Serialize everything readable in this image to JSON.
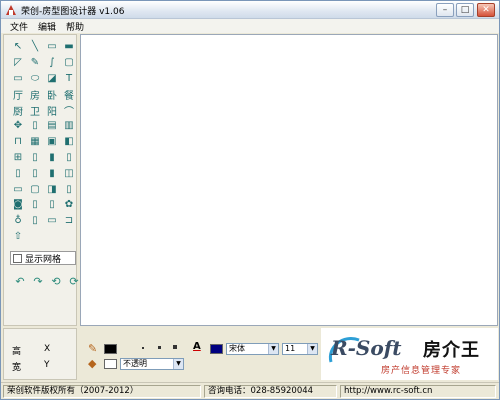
{
  "window": {
    "title": "荣创-房型图设计器 v1.06",
    "buttons": {
      "minimize": "–",
      "maximize": "□",
      "close": "✕"
    }
  },
  "menu": {
    "items": [
      "文件",
      "编辑",
      "帮助"
    ]
  },
  "toolbox": {
    "tools": [
      {
        "name": "pointer-icon",
        "glyph": "↖"
      },
      {
        "name": "line-icon",
        "glyph": "╲"
      },
      {
        "name": "rectangle-icon",
        "glyph": "▭"
      },
      {
        "name": "filled-rectangle-icon",
        "glyph": "▬"
      },
      {
        "name": "eraser-icon",
        "glyph": "◸"
      },
      {
        "name": "pencil-icon",
        "glyph": "✎"
      },
      {
        "name": "curve-icon",
        "glyph": "∫"
      },
      {
        "name": "rounded-rectangle-icon",
        "glyph": "▢"
      },
      {
        "name": "ellipse-filled-icon",
        "glyph": "▭"
      },
      {
        "name": "ellipse-icon",
        "glyph": "⬭"
      },
      {
        "name": "shape-icon",
        "glyph": "◪"
      },
      {
        "name": "text-tool-icon",
        "glyph": "T"
      },
      {
        "name": "kitchen-label-icon",
        "glyph": "厅"
      },
      {
        "name": "room-label-icon",
        "glyph": "房"
      },
      {
        "name": "bedroom-label-icon",
        "glyph": "卧"
      },
      {
        "name": "dining-label-icon",
        "glyph": "餐"
      },
      {
        "name": "cook-label-icon",
        "glyph": "厨"
      },
      {
        "name": "bath-label-icon",
        "glyph": "卫"
      },
      {
        "name": "balcony-label-icon",
        "glyph": "阳"
      },
      {
        "name": "door-arc-icon",
        "glyph": "⌒"
      },
      {
        "name": "compass-icon",
        "glyph": "✥"
      },
      {
        "name": "door-icon",
        "glyph": "▯"
      },
      {
        "name": "window-icon",
        "glyph": "▤"
      },
      {
        "name": "cabinet-icon",
        "glyph": "▥"
      },
      {
        "name": "sofa-icon",
        "glyph": "⊓"
      },
      {
        "name": "bed-icon",
        "glyph": "▦"
      },
      {
        "name": "table-icon",
        "glyph": "▣"
      },
      {
        "name": "closet-icon",
        "glyph": "◧"
      },
      {
        "name": "double-door-icon",
        "glyph": "⊞"
      },
      {
        "name": "narrow-cabinet-icon",
        "glyph": "▯"
      },
      {
        "name": "panel-icon",
        "glyph": "▮"
      },
      {
        "name": "shelf-icon",
        "glyph": "▯"
      },
      {
        "name": "column-icon",
        "glyph": "▯"
      },
      {
        "name": "pillar-icon",
        "glyph": "▯"
      },
      {
        "name": "stand-icon",
        "glyph": "▮"
      },
      {
        "name": "frame-icon",
        "glyph": "◫"
      },
      {
        "name": "desk-icon",
        "glyph": "▭"
      },
      {
        "name": "tv-icon",
        "glyph": "▢"
      },
      {
        "name": "box-icon",
        "glyph": "◨"
      },
      {
        "name": "stool-icon",
        "glyph": "▯"
      },
      {
        "name": "sink-icon",
        "glyph": "◙"
      },
      {
        "name": "bathtub-icon",
        "glyph": "▯"
      },
      {
        "name": "fridge-icon",
        "glyph": "▯"
      },
      {
        "name": "dining-set-icon",
        "glyph": "✿"
      },
      {
        "name": "toilet-icon",
        "glyph": "♁"
      },
      {
        "name": "washer-icon",
        "glyph": "▯"
      },
      {
        "name": "stove-icon",
        "glyph": "▭"
      },
      {
        "name": "stairs-icon",
        "glyph": "⊐"
      },
      {
        "name": "arrow-up-icon",
        "glyph": "⇧"
      }
    ],
    "grid_toggle_label": "显示网格",
    "history_tools": [
      {
        "name": "undo-icon",
        "glyph": "↶"
      },
      {
        "name": "redo-icon",
        "glyph": "↷"
      },
      {
        "name": "rotate-left-icon",
        "glyph": "⟲"
      },
      {
        "name": "rotate-right-icon",
        "glyph": "⟳"
      }
    ]
  },
  "info": {
    "height_label": "高",
    "x_label": "X",
    "width_label": "宽",
    "y_label": "Y"
  },
  "properties": {
    "line_color": "#000000",
    "fill_color": "#ffffff",
    "font_color": "#000080",
    "opacity_value": "不透明",
    "font_name": "宋体",
    "font_size": "11"
  },
  "logo": {
    "brand": "R-Soft",
    "name_cn": "房介王",
    "tagline": "房产信息管理专家"
  },
  "status": {
    "copyright": "荣创软件版权所有（2007-2012）",
    "phone": "咨询电话：028-85920044",
    "website": "http://www.rc-soft.cn"
  }
}
